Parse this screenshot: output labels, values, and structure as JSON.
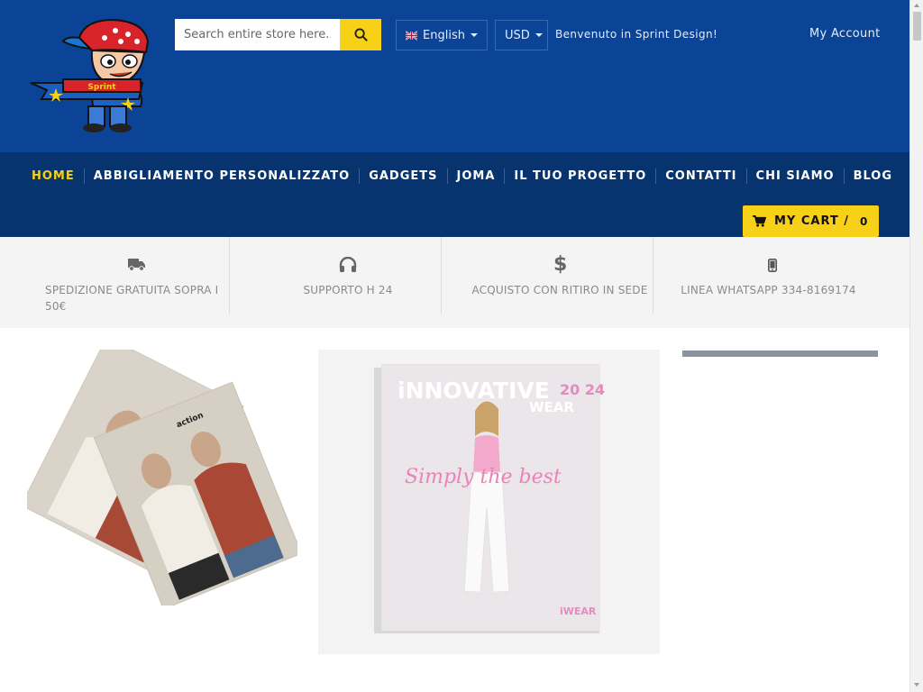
{
  "header": {
    "logo_icon": "sprint-mascot-logo",
    "search": {
      "placeholder": "Search entire store here...",
      "icon": "search-icon"
    },
    "language": {
      "label": "English",
      "flag": "uk-flag-icon"
    },
    "currency": {
      "label": "USD"
    },
    "welcome": "Benvenuto in Sprint Design!",
    "account": "My Account"
  },
  "nav": {
    "items": [
      {
        "label": "HOME",
        "active": true
      },
      {
        "label": "ABBIGLIAMENTO PERSONALIZZATO"
      },
      {
        "label": "GADGETS"
      },
      {
        "label": "JOMA"
      },
      {
        "label": "IL TUO PROGETTO"
      },
      {
        "label": "CONTATTI"
      },
      {
        "label": "CHI SIAMO"
      },
      {
        "label": "BLOG"
      }
    ],
    "cart": {
      "label": "MY CART /",
      "count": "0",
      "icon": "shopping-cart-icon"
    }
  },
  "features": [
    {
      "icon": "truck-icon",
      "text": "SPEDIZIONE GRATUITA SOPRA I 50€"
    },
    {
      "icon": "headphones-icon",
      "text": "SUPPORTO H 24"
    },
    {
      "icon": "dollar-icon",
      "text": "ACQUISTO CON RITIRO IN SEDE"
    },
    {
      "icon": "mobile-phone-icon",
      "text": "LINEA WHATSAPP 334-8169174"
    }
  ],
  "banners": {
    "catalog_left": {
      "brand": "action"
    },
    "catalog_center": {
      "title": "iNNOVATIVE",
      "subtitle": "WEAR",
      "year": "20 24",
      "script": "Simply the best",
      "footer_brand": "iWEAR"
    }
  },
  "colors": {
    "header_blue": "#0b4396",
    "nav_blue": "#07336f",
    "accent_yellow": "#f7d117"
  }
}
